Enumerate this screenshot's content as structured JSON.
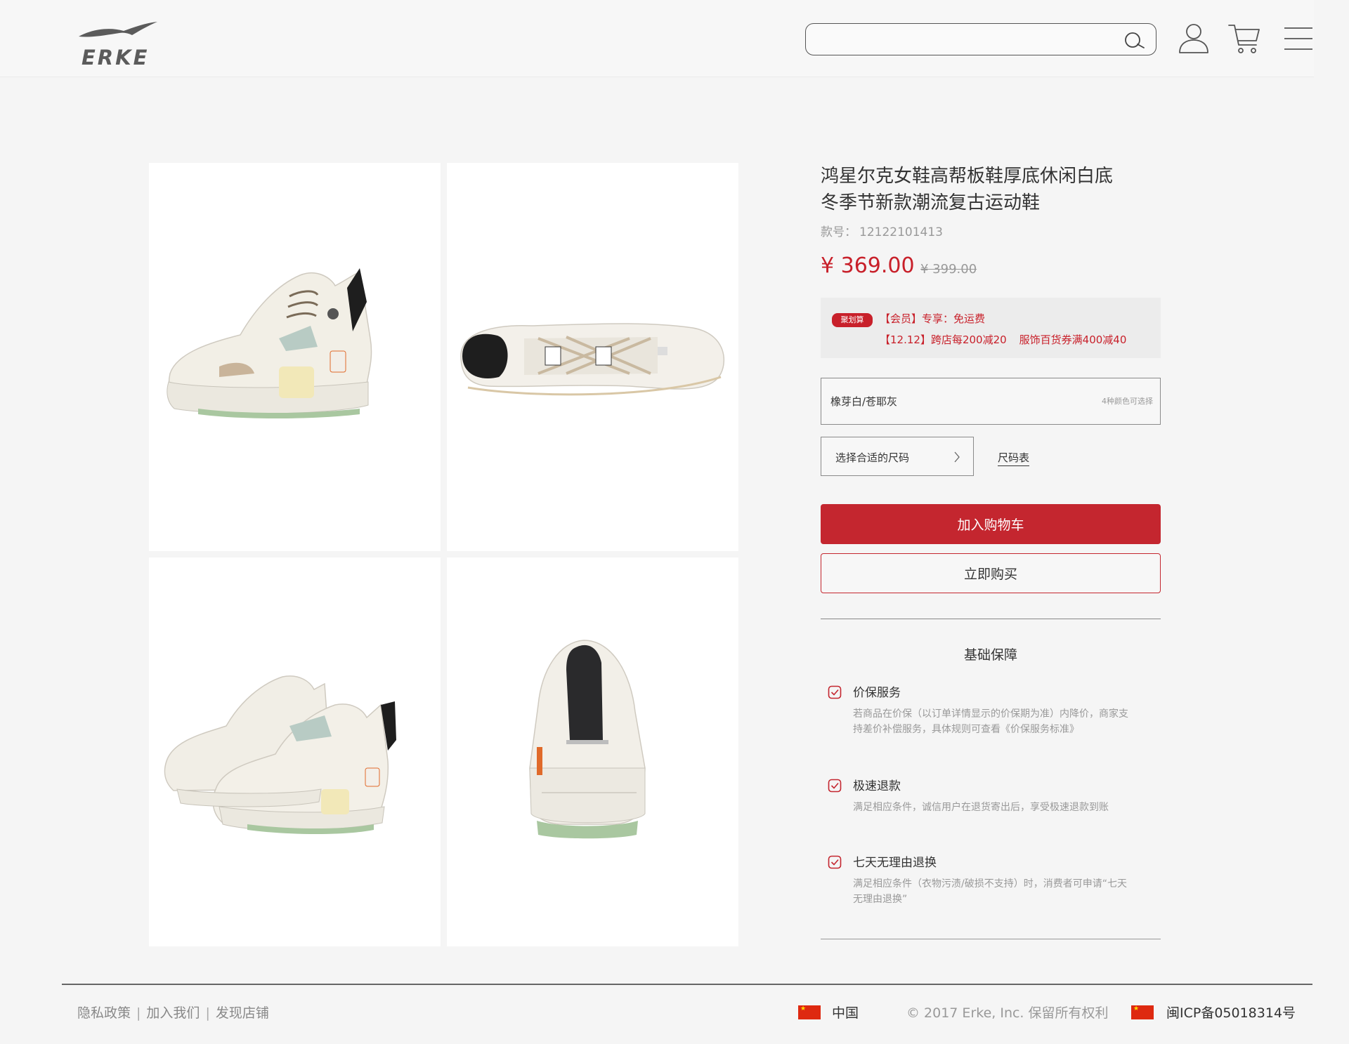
{
  "header": {
    "brand": "ERKE",
    "search": {
      "value": "",
      "placeholder": ""
    },
    "icons": [
      "search-icon",
      "user-icon",
      "cart-icon",
      "menu-icon"
    ]
  },
  "gallery": {
    "images": [
      {
        "alt": "side view",
        "icon": "sneaker-side-image"
      },
      {
        "alt": "top view",
        "icon": "sneaker-top-image"
      },
      {
        "alt": "pair view",
        "icon": "sneaker-pair-image"
      },
      {
        "alt": "back view",
        "icon": "sneaker-back-image"
      }
    ]
  },
  "product": {
    "title_line1": "鸿星尔克女鞋高帮板鞋厚底休闲白底",
    "title_line2": "冬季节新款潮流复古运动鞋",
    "sku_label": "款号：",
    "sku": "12122101413",
    "price": "¥ 369.00",
    "original_price": "¥ 399.00",
    "promo": {
      "tag": "聚划算",
      "line1": "【会员】专享：免运费",
      "line2a": "【12.12】跨店每200减20",
      "line2b": "服饰百货券满400减40"
    },
    "color": {
      "name": "橡芽白/苍耶灰",
      "hint": "4种颜色可选择"
    },
    "size": {
      "label": "选择合适的尺码",
      "chart_link": "尺码表"
    },
    "add_to_cart": "加入购物车",
    "buy_now": "立即购买"
  },
  "guarantee": {
    "title": "基础保障",
    "items": [
      {
        "title": "价保服务",
        "desc": "若商品在价保（以订单详情显示的价保期为准）内降价，商家支持差价补偿服务，具体规则可查看《价保服务标准》"
      },
      {
        "title": "极速退款",
        "desc": "满足相应条件，诚信用户在退货寄出后，享受极速退款到账"
      },
      {
        "title": "七天无理由退换",
        "desc": "满足相应条件（衣物污渍/破损不支持）时，消费者可申请“七天无理由退换”"
      }
    ]
  },
  "footer": {
    "links": [
      "隐私政策",
      "加入我们",
      "发现店铺"
    ],
    "country": "中国",
    "copyright": "© 2017 Erke, Inc. 保留所有权利",
    "icp": "闽ICP备05018314号"
  },
  "colors": {
    "accent": "#c4262f",
    "price": "#c8202a",
    "background": "#f5f5f5"
  }
}
